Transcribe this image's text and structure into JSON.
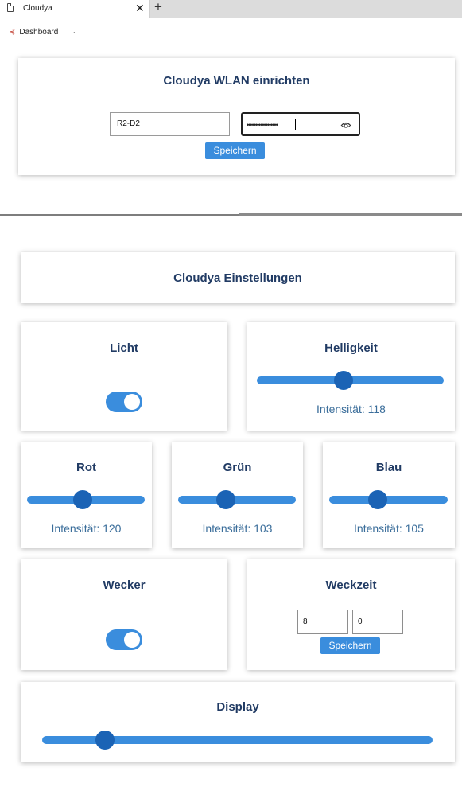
{
  "browser": {
    "tab_title": "Cloudya",
    "close_glyph": "✕",
    "new_tab_glyph": "+",
    "bookmark_label": "Dashboard",
    "bookmark_dot": "."
  },
  "wlan": {
    "title": "Cloudya WLAN einrichten",
    "ssid_value": "R2-D2",
    "password_mask": "••••••••••••••••••",
    "save_label": "Speichern"
  },
  "settings": {
    "title": "Cloudya Einstellungen"
  },
  "licht": {
    "title": "Licht",
    "on": true
  },
  "helligkeit": {
    "title": "Helligkeit",
    "label": "Intensität: 118",
    "value": 118,
    "max": 255
  },
  "rot": {
    "title": "Rot",
    "label": "Intensität: 120",
    "value": 120,
    "max": 255
  },
  "gruen": {
    "title": "Grün",
    "label": "Intensität: 103",
    "value": 103,
    "max": 255
  },
  "blau": {
    "title": "Blau",
    "label": "Intensität: 105",
    "value": 105,
    "max": 255
  },
  "wecker": {
    "title": "Wecker",
    "on": true
  },
  "weckzeit": {
    "title": "Weckzeit",
    "hour": "8",
    "minute": "0",
    "save_label": "Speichern"
  },
  "display": {
    "title": "Display",
    "value": 0.16
  },
  "colors": {
    "accent": "#3a8ddd",
    "thumb": "#1b63b5",
    "heading": "#213b64",
    "intensity_text": "#3a6d9a"
  }
}
